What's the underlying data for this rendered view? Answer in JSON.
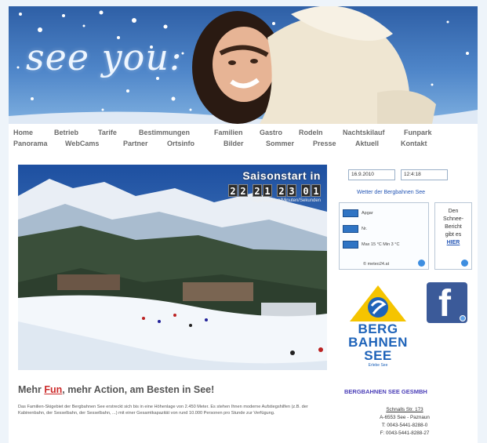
{
  "header": {
    "title": "see you:"
  },
  "nav": {
    "row1": [
      "Home",
      "Betrieb",
      "Tarife",
      "Bestimmungen",
      "Familien",
      "Gastro",
      "Rodeln",
      "Nachtskilauf",
      "Funpark"
    ],
    "row2": [
      "Panorama",
      "WebCams",
      "Partner",
      "Ortsinfo",
      "Bilder",
      "Sommer",
      "Presse",
      "Aktuell",
      "Kontakt"
    ]
  },
  "season": {
    "title": "Saisonstart in",
    "digits": [
      "2",
      "2",
      "2",
      "1",
      "2",
      "3",
      "0",
      "1"
    ],
    "sub": "Tage/Stunden/Minuten/Sekunden"
  },
  "article": {
    "heading_pre": "Mehr ",
    "heading_fun": "Fun",
    "heading_post": ", mehr Action, am Besten in See!",
    "body": "Das Familien-Skigebiet der Bergbahnen See erstreckt sich bis in eine Höhenlage von 2.450 Meter. Es stehen Ihnen moderne Aufstiegshilfen (z.B. der Kabinenbahn, der Sesselbahn, der Sesselbahn, ...) mit einer Gesamtkapazität von rund 10.000 Personen pro Stunde zur Verfügung."
  },
  "sidebar": {
    "date": "16.9.2010",
    "time": "12:4:18",
    "weather_link": "Wetter der Bergbahnen See",
    "weather_rows": [
      {
        "label": "Apgar"
      },
      {
        "label": "Nr."
      },
      {
        "label": "Max  15 °C  Min  3 °C"
      }
    ],
    "weather_footer": "© meteo24.at",
    "snow_lines": [
      "Den",
      "Schnee-",
      "Bericht",
      "gibt es"
    ],
    "snow_link": "HIER",
    "logo_lines": [
      "BERG",
      "BAHNEN",
      "SEE"
    ],
    "logo_sub": "Erlebe See",
    "company_link": "BERGBAHNEN SEE GESMBH",
    "address": [
      "Schnalls Str. 173",
      "A-6553 See - Paznaun",
      "T: 0043-5441-8288-0",
      "F: 0043-5441-8288-27"
    ]
  },
  "colors": {
    "accent": "#2456b5",
    "fun": "#cc2a2a",
    "facebook": "#3b5a99"
  }
}
